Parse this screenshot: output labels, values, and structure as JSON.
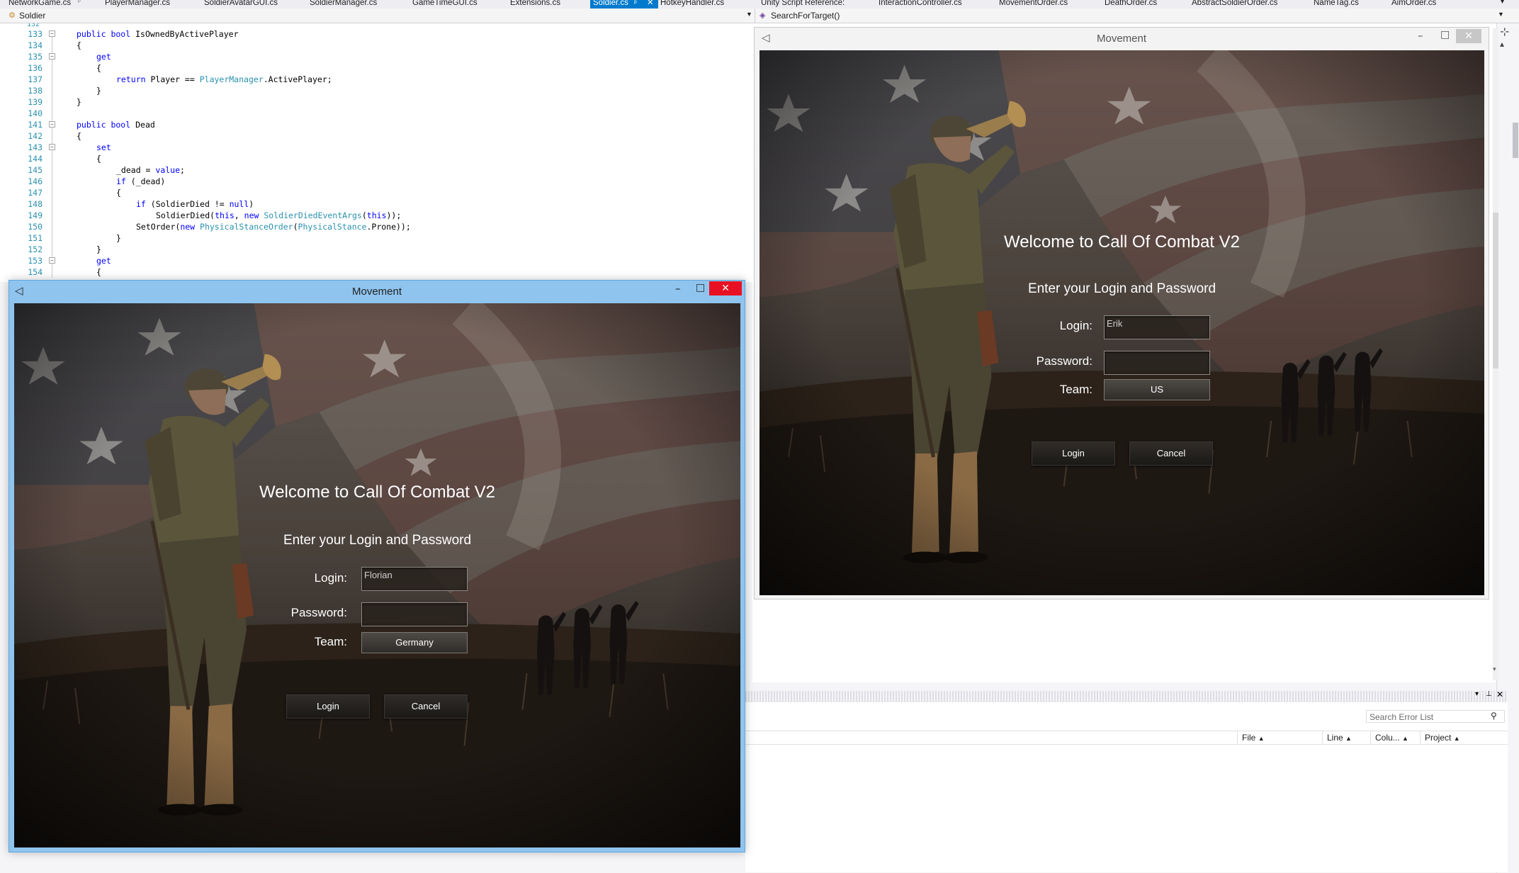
{
  "tabs": [
    "NetworkGame.cs",
    "PlayerManager.cs",
    "SoldierAvatarGUI.cs",
    "SoldierManager.cs",
    "GameTimeGUI.cs",
    "Extensions.cs",
    "Soldier.cs",
    "HotkeyHandler.cs",
    "Unity Script Reference:",
    "InteractionController.cs",
    "MovementOrder.cs",
    "DeathOrder.cs",
    "AbstractSoldierOrder.cs",
    "NameTag.cs",
    "AimOrder.cs"
  ],
  "active_tab": "Soldier.cs",
  "navbar": {
    "type_dropdown": "Soldier",
    "member_dropdown": "SearchForTarget()"
  },
  "code": [
    {
      "n": "133",
      "t": "public bool IsOwnedByActivePlayer"
    },
    {
      "n": "134",
      "t": "{"
    },
    {
      "n": "135",
      "t": "get"
    },
    {
      "n": "136",
      "t": "{"
    },
    {
      "n": "137",
      "t": "return Player == PlayerManager.ActivePlayer;"
    },
    {
      "n": "138",
      "t": "}"
    },
    {
      "n": "139",
      "t": "}"
    },
    {
      "n": "140",
      "t": ""
    },
    {
      "n": "141",
      "t": "public bool Dead"
    },
    {
      "n": "142",
      "t": "{"
    },
    {
      "n": "143",
      "t": "set"
    },
    {
      "n": "144",
      "t": "{"
    },
    {
      "n": "145",
      "t": "_dead = value;"
    },
    {
      "n": "146",
      "t": "if (_dead)"
    },
    {
      "n": "147",
      "t": "{"
    },
    {
      "n": "148",
      "t": "if (SoldierDied != null)"
    },
    {
      "n": "149",
      "t": "SoldierDied(this, new SoldierDiedEventArgs(this));"
    },
    {
      "n": "150",
      "t": "SetOrder(new PhysicalStanceOrder(PhysicalStance.Prone));"
    },
    {
      "n": "151",
      "t": "}"
    },
    {
      "n": "152",
      "t": "}"
    },
    {
      "n": "153",
      "t": "get"
    },
    {
      "n": "154",
      "t": "{"
    }
  ],
  "window_left": {
    "title": "Movement",
    "welcome": "Welcome to Call Of Combat V2",
    "subtitle": "Enter your Login and Password",
    "login_label": "Login:",
    "login_value": "Florian",
    "password_label": "Password:",
    "password_value": "",
    "team_label": "Team:",
    "team_value": "Germany",
    "login_button": "Login",
    "cancel_button": "Cancel"
  },
  "window_right": {
    "title": "Movement",
    "welcome": "Welcome to Call Of Combat V2",
    "subtitle": "Enter your Login and Password",
    "login_label": "Login:",
    "login_value": "Erik",
    "password_label": "Password:",
    "password_value": "",
    "team_label": "Team:",
    "team_value": "US",
    "login_button": "Login",
    "cancel_button": "Cancel"
  },
  "error_list": {
    "search_placeholder": "Search Error List",
    "columns": [
      "File",
      "Line",
      "Colu...",
      "Project"
    ]
  },
  "colors": {
    "accent": "#007acc",
    "active_title_bar": "#8fc4ee",
    "close_button": "#e81123"
  }
}
